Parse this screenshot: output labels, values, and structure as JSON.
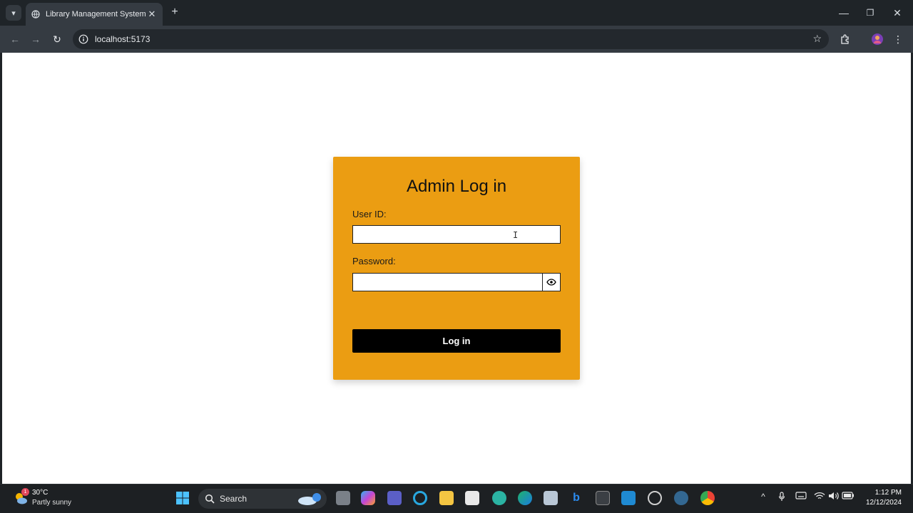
{
  "browser": {
    "tab_title": "Library Management System",
    "tab_close": "✕",
    "new_tab": "+",
    "url": "localhost:5173",
    "window_minimize": "—",
    "window_restore": "❐",
    "window_close": "✕"
  },
  "login": {
    "title": "Admin Log in",
    "user_id_label": "User ID:",
    "user_id_value": "",
    "password_label": "Password:",
    "password_value": "",
    "button_label": "Log in"
  },
  "taskbar": {
    "weather_badge": "1",
    "weather_temp": "30°C",
    "weather_condition": "Partly sunny",
    "search_label": "Search",
    "time": "1:12 PM",
    "date": "12/12/2024"
  },
  "colors": {
    "card": "#eb9d12",
    "button": "#000000",
    "taskbar": "#1d2023"
  }
}
